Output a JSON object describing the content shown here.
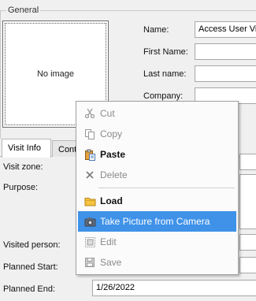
{
  "group": {
    "title": "General"
  },
  "photo": {
    "placeholder": "No image"
  },
  "fields": {
    "name_label": "Name:",
    "name_value": "Access User Visitor",
    "first_name_label": "First Name:",
    "first_name_value": "",
    "last_name_label": "Last name:",
    "last_name_value": "",
    "company_label": "Company:",
    "company_value": ""
  },
  "tabs": {
    "visit_info": "Visit Info",
    "contact": "Contact"
  },
  "visit": {
    "visit_zone_label": "Visit zone:",
    "purpose_label": "Purpose:",
    "visited_person_label": "Visited person:",
    "planned_start_label": "Planned Start:",
    "planned_end_label": "Planned End:",
    "planned_end_value": "1/26/2022"
  },
  "context_menu": {
    "items": [
      {
        "label": "Cut",
        "icon": "scissors-icon",
        "state": "disabled"
      },
      {
        "label": "Copy",
        "icon": "copy-icon",
        "state": "disabled"
      },
      {
        "label": "Paste",
        "icon": "clipboard-paste-icon",
        "state": "bold"
      },
      {
        "label": "Delete",
        "icon": "delete-x-icon",
        "state": "disabled"
      },
      {
        "label": "Load",
        "icon": "folder-icon",
        "state": "bold"
      },
      {
        "label": "Take Picture from Camera",
        "icon": "camera-icon",
        "state": "highlighted"
      },
      {
        "label": "Edit",
        "icon": "edit-icon",
        "state": "disabled"
      },
      {
        "label": "Save",
        "icon": "floppy-disk-icon",
        "state": "disabled"
      }
    ]
  }
}
